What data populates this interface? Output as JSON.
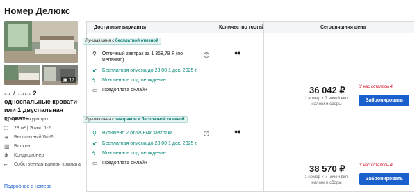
{
  "room": {
    "title": "Номер Делюкс",
    "photo_count": "17",
    "bed_icons": "▭ / ▭▭",
    "bed_text": "2 односпальные кровати или 1 двуспальная кровать",
    "amenities": [
      {
        "icon": "no-smoking-icon",
        "glyph": "⊘",
        "label": "Для некурящих"
      },
      {
        "icon": "area-icon",
        "glyph": "⛶",
        "label": "28 м² | Этаж: 1-2"
      },
      {
        "icon": "wifi-icon",
        "glyph": "≋",
        "label": "Бесплатный Wi-Fi"
      },
      {
        "icon": "balcony-icon",
        "glyph": "▥",
        "label": "Балкон"
      },
      {
        "icon": "snowflake-icon",
        "glyph": "✻",
        "label": "Кондиционер"
      },
      {
        "icon": "bathroom-icon",
        "glyph": "⌐",
        "label": "Собственная ванная комната"
      }
    ],
    "more_link": "Подробнее о номере"
  },
  "table": {
    "col_options": "Доступные варианты",
    "col_guests": "Количество гостей",
    "col_price": "Сегодняшняя цена"
  },
  "offers": [
    {
      "tag_prefix": "Лучшая цена с",
      "tag_bold": "бесплатной отменой",
      "features": [
        {
          "icon": "cutlery-icon",
          "glyph": "⚲",
          "label": "Отличный завтрак за 1 358,78 ₽ (по желанию)",
          "style": "black"
        },
        {
          "icon": "check-circle-icon",
          "glyph": "✔",
          "label": "Бесплатная отмена до 23:00 1 дек. 2025 г.",
          "style": "teal"
        },
        {
          "icon": "lightning-icon",
          "glyph": "ϟ",
          "label": "Мгновенное подтверждение",
          "style": "teal"
        },
        {
          "icon": "card-icon",
          "glyph": "▭",
          "label": "Предоплата онлайн",
          "style": "black"
        }
      ],
      "help": "?",
      "guests": "●● ",
      "left_note": "У нас осталось 4!",
      "price": "36 042 ₽",
      "price_note": "1 номер × 7 ночей вкл. налоги и сборы",
      "button": "Забронировать"
    },
    {
      "tag_prefix": "Лучшая цена с",
      "tag_bold": "завтраком и бесплатной отменой",
      "features": [
        {
          "icon": "cutlery-icon",
          "glyph": "⚲",
          "label": "Включено 2 отличных завтрака",
          "style": "teal"
        },
        {
          "icon": "check-circle-icon",
          "glyph": "✔",
          "label": "Бесплатная отмена до 23:00 1 дек. 2025 г.",
          "style": "teal"
        },
        {
          "icon": "lightning-icon",
          "glyph": "ϟ",
          "label": "Мгновенное подтверждение",
          "style": "teal"
        },
        {
          "icon": "card-icon",
          "glyph": "▭",
          "label": "Предоплата онлайн",
          "style": "black"
        }
      ],
      "help": "?",
      "guests": "●● ",
      "left_note": "У нас осталось 4!",
      "price": "38 570 ₽",
      "price_note": "1 номер × 7 ночей вкл. налоги и сборы",
      "button": "Забронировать"
    }
  ]
}
